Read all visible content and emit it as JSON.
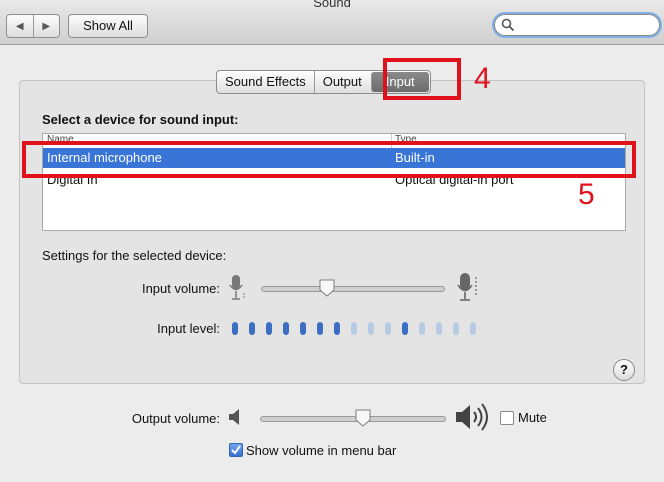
{
  "window": {
    "title": "Sound"
  },
  "toolbar": {
    "back_glyph": "◀",
    "forward_glyph": "▶",
    "show_all_label": "Show All",
    "search_placeholder": ""
  },
  "tabs": [
    {
      "label": "Sound Effects",
      "active": false
    },
    {
      "label": "Output",
      "active": false
    },
    {
      "label": "Input",
      "active": true
    }
  ],
  "input_pane": {
    "section_title": "Select a device for sound input:",
    "columns": {
      "name": "Name",
      "type": "Type"
    },
    "devices": [
      {
        "name": "Internal microphone",
        "type": "Built-in",
        "selected": true
      },
      {
        "name": "Digital In",
        "type": "Optical digital-in port",
        "selected": false
      }
    ],
    "settings_label": "Settings for the selected device:",
    "input_volume_label": "Input volume:",
    "input_volume_fraction": 0.36,
    "input_level_label": "Input level:",
    "input_level": {
      "total": 15,
      "lit": [
        1,
        1,
        1,
        1,
        1,
        1,
        1,
        0,
        0,
        0,
        1,
        0,
        0,
        0,
        0
      ]
    },
    "help_label": "?"
  },
  "output": {
    "volume_label": "Output volume:",
    "volume_fraction": 0.56,
    "mute_label": "Mute",
    "mute_checked": false,
    "show_volume_label": "Show volume in menu bar",
    "show_volume_checked": true
  },
  "annotations": {
    "label_4": "4",
    "label_5": "5",
    "color": "#e0111b"
  },
  "colors": {
    "selection": "#3875d7",
    "level_on": "#3c6fc4",
    "level_off": "#b8cbe5"
  }
}
